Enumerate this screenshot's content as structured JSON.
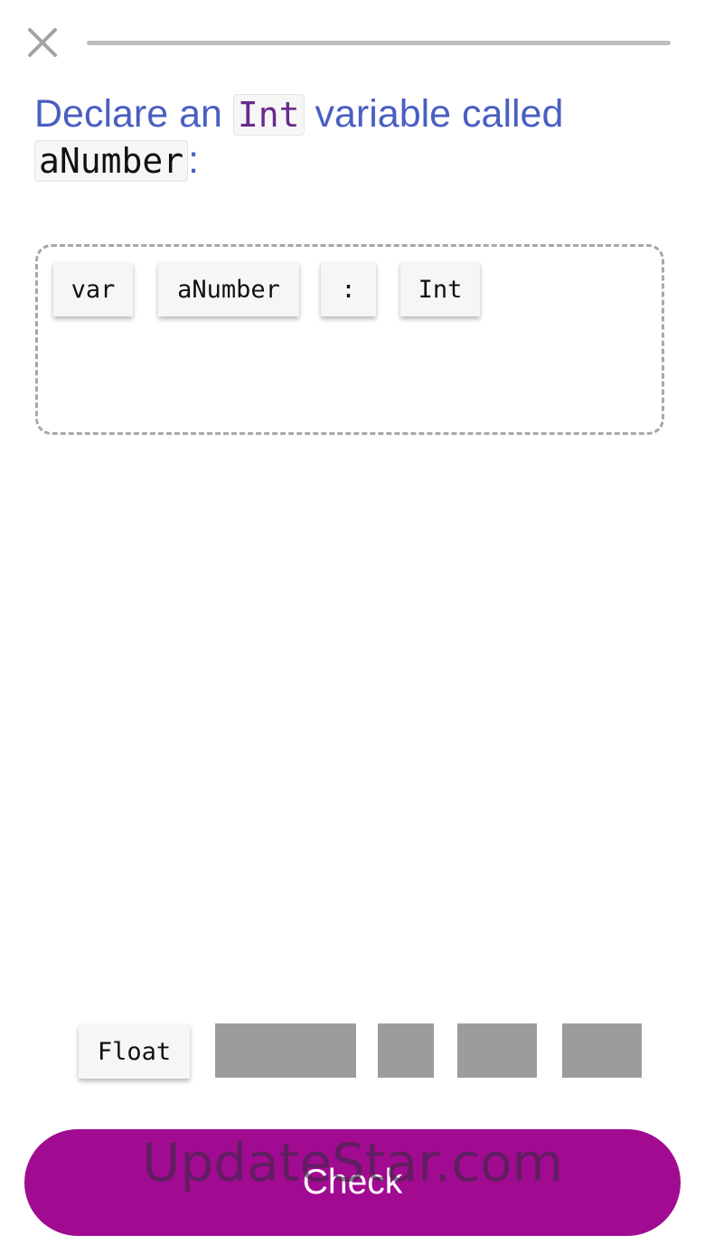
{
  "header": {
    "close_icon": "close-icon",
    "progress_fraction": 0.0
  },
  "prompt": {
    "text_before": "Declare an ",
    "code_type": "Int",
    "text_middle": " variable called",
    "code_name": "aNumber",
    "text_after": ":"
  },
  "answer_tokens": [
    "var",
    "aNumber",
    ":",
    "Int"
  ],
  "word_bank": {
    "tokens": [
      "Float"
    ],
    "used_slots": 4
  },
  "check_button": {
    "label": "Check"
  },
  "watermark": {
    "text": "UpdateStar.com"
  },
  "colors": {
    "prompt_text": "#4a5fc1",
    "accent": "#a10b91",
    "code_keyword": "#6a2a8c"
  }
}
